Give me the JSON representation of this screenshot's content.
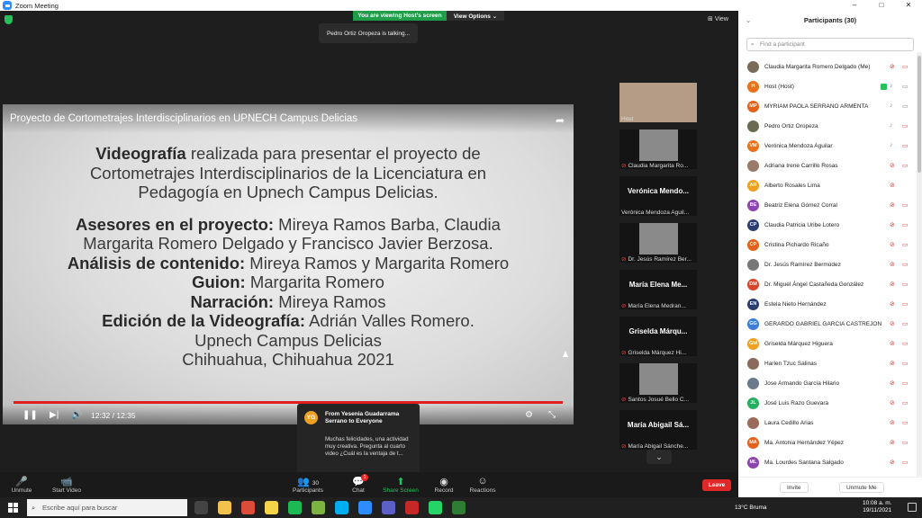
{
  "window": {
    "title": "Zoom Meeting",
    "controls": [
      "–",
      "□",
      "✕"
    ]
  },
  "meeting": {
    "viewing_banner": "You are viewing Host's screen",
    "view_options": "View Options ⌄",
    "talking": "Pedro Ortiz Oropeza is talking...",
    "view_label": "View"
  },
  "shared_video": {
    "title": "Proyecto de Cortometrajes Interdisciplinarios en UPNECH Campus Delicias",
    "slide_lines": [
      {
        "bold": "Videografía",
        "rest": " realizada para presentar el proyecto de"
      },
      {
        "bold": "",
        "rest": "Cortometrajes Interdisciplinarios de la Licenciatura en"
      },
      {
        "bold": "",
        "rest": "Pedagogía en Upnech Campus Delicias."
      },
      {
        "bold": "",
        "rest": ""
      },
      {
        "bold": "Asesores en el proyecto:",
        "rest": " Mireya Ramos Barba, Claudia"
      },
      {
        "bold": "",
        "rest": "Margarita Romero Delgado y Francisco Javier Berzosa."
      },
      {
        "bold": "Análisis de contenido:",
        "rest": " Mireya Ramos y Margarita Romero"
      },
      {
        "bold": "Guion:",
        "rest": " Margarita Romero"
      },
      {
        "bold": "Narración:",
        "rest": " Mireya Ramos"
      },
      {
        "bold": "Edición de la Videografía:",
        "rest": " Adrián Valles Romero."
      },
      {
        "bold": "",
        "rest": "Upnech Campus Delicias"
      },
      {
        "bold": "",
        "rest": "Chihuahua, Chihuahua 2021"
      }
    ],
    "time": "12:32 / 12:35",
    "progress": 0.996
  },
  "thumbnails": [
    {
      "type": "video",
      "name": "Host",
      "muted": false
    },
    {
      "type": "video",
      "name": "Claudia Margarita Ro...",
      "muted": true
    },
    {
      "type": "name",
      "big": "Verónica Mendo...",
      "name": "Verónica Mendoza Aguil...",
      "muted": false
    },
    {
      "type": "video",
      "name": "Dr. Jesús Ramírez Ber...",
      "muted": true
    },
    {
      "type": "name",
      "big": "María Elena Me...",
      "name": "María Elena Medran...",
      "muted": true
    },
    {
      "type": "name",
      "big": "Griselda Márqu...",
      "name": "Griselda Márquez Hi...",
      "muted": true
    },
    {
      "type": "video",
      "name": "Santos Josué Bello C...",
      "muted": true
    },
    {
      "type": "name",
      "big": "María Abigail Sá...",
      "name": "María Abigail Sánche...",
      "muted": true
    }
  ],
  "chat_popup": {
    "avatar": "YG",
    "from": "From Yesenia Guadarrama Serrano to Everyone",
    "message": "Muchas felicidades, una actividad muy creativa. Pregunta al cuarto video ¿Cuál es la ventaja de t..."
  },
  "toolbar": {
    "unmute": "Unmute",
    "start_video": "Start Video",
    "participants": "Participants",
    "participants_count": "30",
    "chat": "Chat",
    "chat_badge": "1",
    "share_screen": "Share Screen",
    "record": "Record",
    "reactions": "Reactions",
    "leave": "Leave"
  },
  "panel": {
    "title": "Participants (30)",
    "search_placeholder": "Find a participant",
    "invite": "Invite",
    "unmute_me": "Unmute Me",
    "participants": [
      {
        "initials": "",
        "color": "#7a6a5a",
        "name": "Claudia Margarita Romero Delgado (Me)",
        "mic": "muted",
        "cam": "off"
      },
      {
        "initials": "H",
        "color": "#e8731e",
        "name": "Host (Host)",
        "mic": "on",
        "cam": "on",
        "sharing": true
      },
      {
        "initials": "MP",
        "color": "#e0621d",
        "name": "MYRIAM PAOLA SERRANO ARMENTA",
        "mic": "on",
        "cam": "on"
      },
      {
        "initials": "",
        "color": "#6a6a50",
        "name": "Pedro Ortiz Oropeza",
        "mic": "on",
        "cam": "off"
      },
      {
        "initials": "VM",
        "color": "#e8731e",
        "name": "Verónica Mendoza Aguilar",
        "mic": "on",
        "cam": "off"
      },
      {
        "initials": "",
        "color": "#9a7a6a",
        "name": "Adriana Irene Carrillo Rosas",
        "mic": "muted",
        "cam": "off"
      },
      {
        "initials": "AR",
        "color": "#f0a020",
        "name": "Alberto Rosales Lima",
        "mic": "muted",
        "cam": "none"
      },
      {
        "initials": "BE",
        "color": "#8e44ad",
        "name": "Beatriz Elena Gómez Corral",
        "mic": "muted",
        "cam": "off"
      },
      {
        "initials": "CP",
        "color": "#2c3e70",
        "name": "Claudia Patricia Uribe Lotero",
        "mic": "muted",
        "cam": "off"
      },
      {
        "initials": "CP",
        "color": "#e0621d",
        "name": "Cristina Pichardo Ricaño",
        "mic": "muted",
        "cam": "off"
      },
      {
        "initials": "",
        "color": "#777777",
        "name": "Dr. Jesús Ramírez Bermúdez",
        "mic": "muted",
        "cam": "off"
      },
      {
        "initials": "DM",
        "color": "#d9452b",
        "name": "Dr. Miguel Ángel Castañeda González",
        "mic": "muted",
        "cam": "off"
      },
      {
        "initials": "EN",
        "color": "#2c3e70",
        "name": "Estela Nieto Hernández",
        "mic": "muted",
        "cam": "off"
      },
      {
        "initials": "GG",
        "color": "#3b7dd8",
        "name": "GERARDO GABRIEL GARCIA CASTREJON",
        "mic": "muted",
        "cam": "off"
      },
      {
        "initials": "GM",
        "color": "#f0a020",
        "name": "Griselda Márquez Higuera",
        "mic": "muted",
        "cam": "off"
      },
      {
        "initials": "",
        "color": "#8a6a5a",
        "name": "Harlen Tzuc Salinas",
        "mic": "muted",
        "cam": "off"
      },
      {
        "initials": "",
        "color": "#6a7a8a",
        "name": "Jose Armando García Hilario",
        "mic": "muted",
        "cam": "off"
      },
      {
        "initials": "JL",
        "color": "#27ae60",
        "name": "José Luis Razo Guevara",
        "mic": "muted",
        "cam": "off"
      },
      {
        "initials": "",
        "color": "#9a6a5a",
        "name": "Laura Cedillo Arias",
        "mic": "muted",
        "cam": "off"
      },
      {
        "initials": "MA",
        "color": "#e0621d",
        "name": "Ma. Antonia Hernández Yépez",
        "mic": "muted",
        "cam": "off"
      },
      {
        "initials": "ML",
        "color": "#8e44ad",
        "name": "Ma. Lourdes Santana Salgado",
        "mic": "muted",
        "cam": "off"
      }
    ]
  },
  "taskbar": {
    "search_placeholder": "Escribe aquí para buscar",
    "apps": [
      {
        "name": "task-view",
        "color": "#444444"
      },
      {
        "name": "file-explorer",
        "color": "#f2c14e"
      },
      {
        "name": "chrome",
        "color": "#dd4b39"
      },
      {
        "name": "sticky-notes",
        "color": "#f5d547"
      },
      {
        "name": "spotify",
        "color": "#1db954"
      },
      {
        "name": "app",
        "color": "#7cb342"
      },
      {
        "name": "skype",
        "color": "#00aff0"
      },
      {
        "name": "zoom",
        "color": "#2d8cff"
      },
      {
        "name": "teams",
        "color": "#5b5fc7"
      },
      {
        "name": "app-red",
        "color": "#c62828"
      },
      {
        "name": "whatsapp",
        "color": "#25d366"
      },
      {
        "name": "app-green",
        "color": "#2e7d32"
      }
    ],
    "weather": "13°C  Bruma",
    "time": "10:08 a. m.",
    "date": "19/11/2021"
  }
}
